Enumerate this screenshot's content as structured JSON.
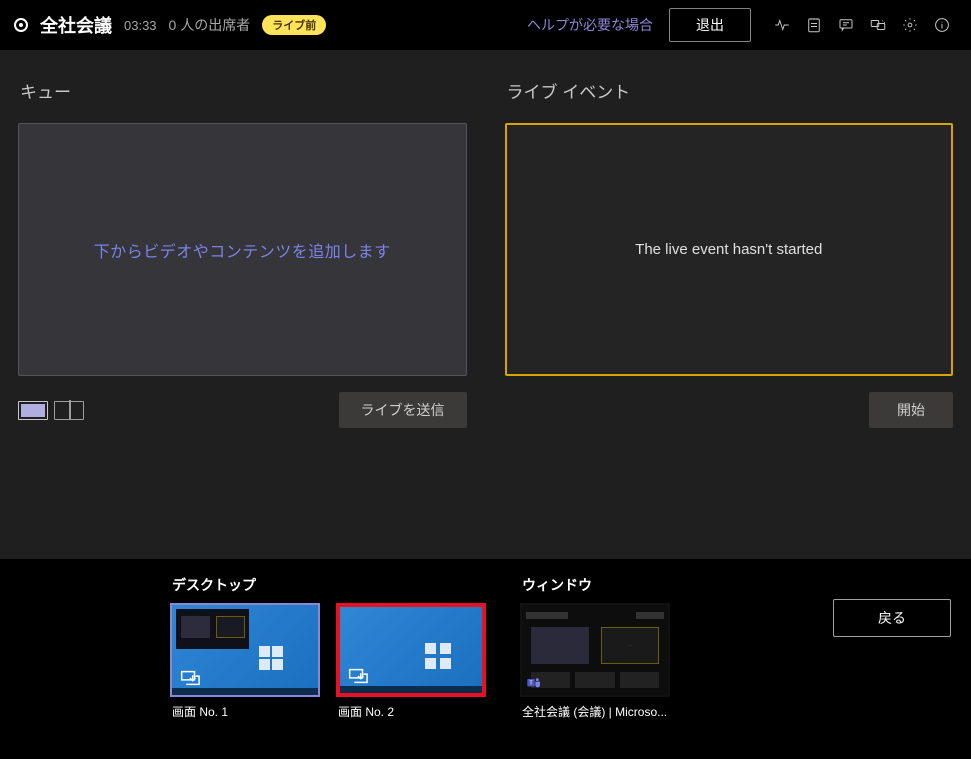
{
  "topbar": {
    "meeting_title": "全社会議",
    "timer": "03:33",
    "attendees": "0 人の出席者",
    "badge": "ライブ前",
    "help": "ヘルプが必要な場合",
    "leave": "退出"
  },
  "queue": {
    "header": "キュー",
    "placeholder": "下からビデオやコンテンツを追加します",
    "send_live": "ライブを送信"
  },
  "live": {
    "header": "ライブ イベント",
    "status": "The live event hasn't started",
    "start": "開始"
  },
  "sources": {
    "desktop_header": "デスクトップ",
    "window_header": "ウィンドウ",
    "screen1": "画面 No. 1",
    "screen2": "画面 No. 2",
    "window1": "全社会議 (会議) | Microso...",
    "back": "戻る"
  }
}
